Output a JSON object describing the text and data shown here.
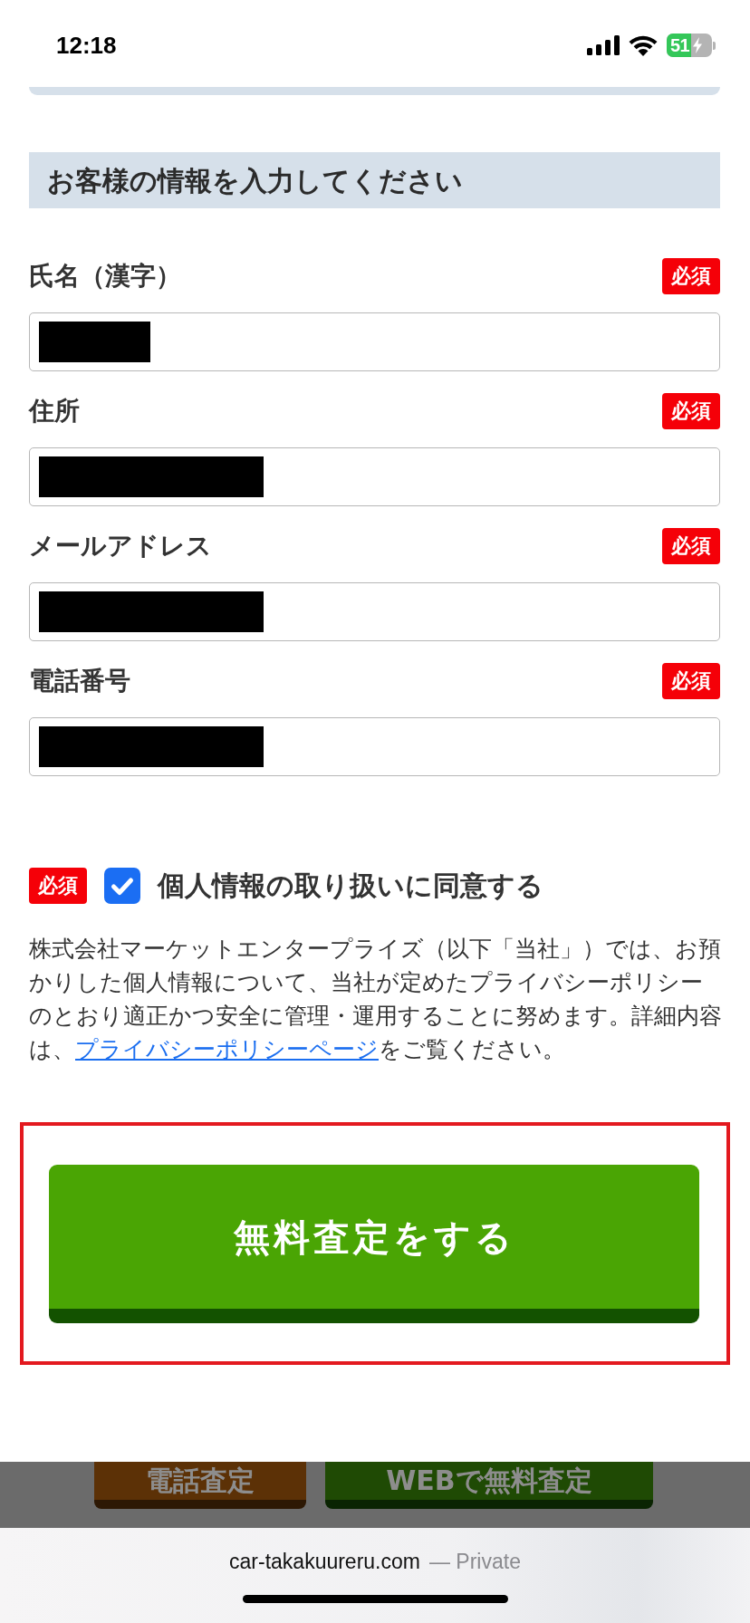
{
  "status_bar": {
    "time": "12:18",
    "battery": "51"
  },
  "section": {
    "title": "お客様の情報を入力してください"
  },
  "fields": [
    {
      "label": "氏名（漢字）",
      "badge": "必須",
      "redacted": true,
      "kind": "short"
    },
    {
      "label": "住所",
      "badge": "必須",
      "redacted": true,
      "kind": "long"
    },
    {
      "label": "メールアドレス",
      "badge": "必須",
      "redacted": true,
      "kind": "long"
    },
    {
      "label": "電話番号",
      "badge": "必須",
      "redacted": true,
      "kind": "long"
    }
  ],
  "consent": {
    "badge": "必須",
    "checked": true,
    "label": "個人情報の取り扱いに同意する"
  },
  "notice": {
    "text": "株式会社マーケットエンタープライズ（以下「当社」）では、お預かりした個人情報について、当社が定めたプライバシーポリシーのとおり適正かつ安全に管理・運用することに努めます。詳細内容は、",
    "link": "プライバシーポリシーページ",
    "after": "をご覧ください。"
  },
  "submit_button": {
    "label": "無料査定をする",
    "highlighted": true
  },
  "bottom_bar": {
    "buttons": [
      {
        "label": "電話査定",
        "kind": "phone"
      },
      {
        "label": "WEBで無料査定",
        "kind": "web"
      }
    ]
  },
  "browser": {
    "url": "car-takakuureru.com",
    "mode": "— Private"
  }
}
